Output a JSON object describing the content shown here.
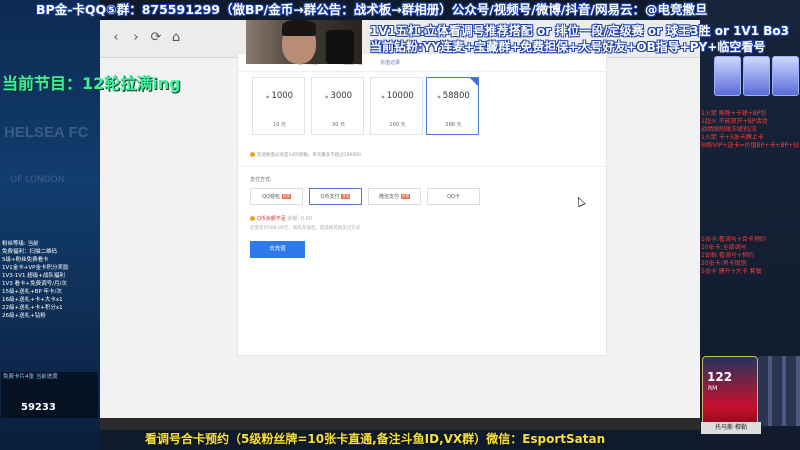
{
  "overlay": {
    "top_banner": "BP金-卡QQ⑤群：875591299（做BP/金币→群公告：战术板→群相册）公众号/视频号/微博/抖音/网易云：@电竞撒旦",
    "info_line_1": "1V1五杠:立体看调号推荐搭配 or 排位一段/定级赛 or 球王3胜 or 1V1 Bo3",
    "info_line_2": "当前钻粉:YY连麦+宝藏群+免费担保+大号好友+OB指导+PY+临空看号",
    "program": "当前节目：12轮拉满ing",
    "bottom_banner": "看调号合卡预约（5级粉丝牌=10张卡直通,备注斗鱼ID,VX群）微信：EsportSatan",
    "club_text": "HELSEA FC",
    "club_sub": "OF LONDON",
    "left_list": [
      "粉丝等级: 当前",
      "免费福利：扫描二维码",
      "5级+粉丝免费看卡",
      "1V1金卡+VP金卡积分奖励",
      "1V3-1V1 超级+战队福利",
      "1V3 看卡+免费调号/月/次",
      "15级+送礼+BP 年卡/次",
      "16级+送礼+卡+大卡x1",
      "22级+送礼+卡+积分x1",
      "26级+送礼+钻粉"
    ],
    "left_stats_line": "免费卡片4张 当前进度",
    "left_stats_count": "59233",
    "right_red": [
      "1火箭 推荐+卡顿+BP包",
      "1超火 不能双开+BP活动",
      "战绩限制球王级别/次",
      "1火箭 卡+5张卡牌上卡",
      "钻粉VIP+送卡=价值BP+卡+BP+钻",
      "5张卡:看调号+合卡预约",
      "10张卡:全部调号",
      "1钻粉:看调号+预约",
      "20张卡:黑卡级别",
      "5张卡 建升+大卡 套餐"
    ],
    "player_rating": "122",
    "player_pos": "RM",
    "name_tag": "托马斯·穆勒"
  },
  "browser": {
    "back_icon": "‹",
    "forward_icon": "›",
    "refresh_icon": "⟳",
    "home_icon": "⌂",
    "tabs": [
      "金币充值",
      "全国大区",
      "充值记录"
    ],
    "packages": [
      {
        "amount": "1000",
        "price": "10 元",
        "selected": false
      },
      {
        "amount": "3000",
        "price": "30 元",
        "selected": false
      },
      {
        "amount": "10000",
        "price": "100 元",
        "selected": false
      },
      {
        "amount": "58800",
        "price": "588 元",
        "selected": true
      }
    ],
    "notice": "充值数量必须是10的倍数，单次最多不超过100000",
    "payment_label": "支付方式:",
    "payment_methods": [
      {
        "label": "QQ钱包",
        "tag": "优惠",
        "selected": false
      },
      {
        "label": "Q币支付",
        "tag": "优惠",
        "selected": true
      },
      {
        "label": "微信支付",
        "tag": "优惠",
        "selected": false
      },
      {
        "label": "QQ卡",
        "tag": "",
        "selected": false
      }
    ],
    "balance_warning": "Q币余额不足",
    "balance_detail": "余额: 0.00",
    "hint": "还需支付588.00元，请先充值后，或选择其他支付方式",
    "confirm_button": "去充值"
  }
}
